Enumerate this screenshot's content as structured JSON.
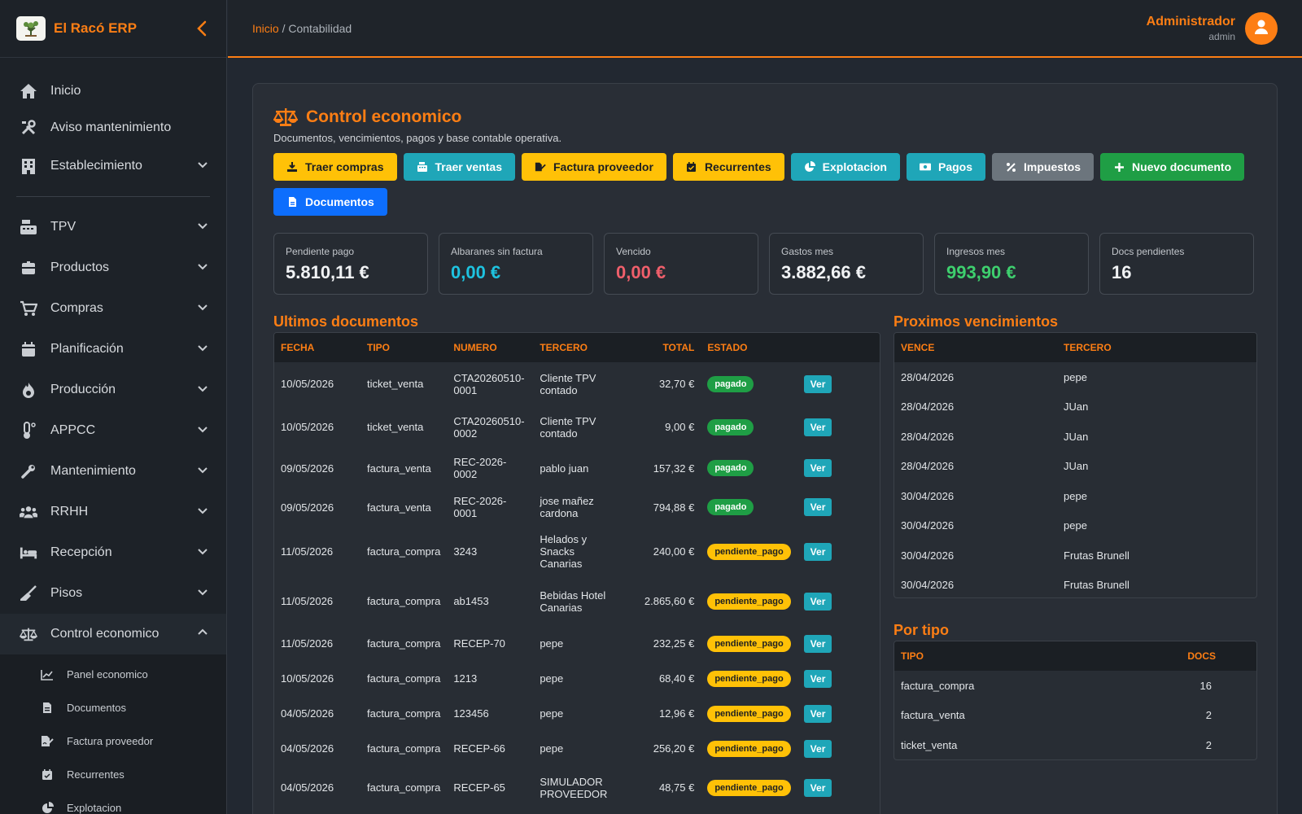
{
  "brand": {
    "name": "El Racó ERP"
  },
  "sidebar": {
    "items": [
      {
        "label": "Inicio",
        "icon": "home-icon"
      },
      {
        "label": "Aviso mantenimiento",
        "icon": "tools-icon"
      },
      {
        "label": "Establecimiento",
        "icon": "building-icon"
      }
    ],
    "groups": [
      {
        "label": "TPV",
        "icon": "cash-register-icon"
      },
      {
        "label": "Productos",
        "icon": "box-icon"
      },
      {
        "label": "Compras",
        "icon": "cart-icon"
      },
      {
        "label": "Planificación",
        "icon": "calendar-icon"
      },
      {
        "label": "Producción",
        "icon": "fire-icon"
      },
      {
        "label": "APPCC",
        "icon": "thermometer-icon"
      },
      {
        "label": "Mantenimiento",
        "icon": "wrench-icon"
      },
      {
        "label": "RRHH",
        "icon": "users-icon"
      },
      {
        "label": "Recepción",
        "icon": "bed-icon"
      },
      {
        "label": "Pisos",
        "icon": "broom-icon"
      },
      {
        "label": "Control economico",
        "icon": "scale-icon"
      }
    ],
    "subitems": [
      {
        "label": "Panel economico",
        "icon": "chart-line-icon"
      },
      {
        "label": "Documentos",
        "icon": "file-icon"
      },
      {
        "label": "Factura proveedor",
        "icon": "file-signature-icon"
      },
      {
        "label": "Recurrentes",
        "icon": "calendar-check-icon"
      },
      {
        "label": "Explotacion",
        "icon": "pie-chart-icon"
      }
    ]
  },
  "topbar": {
    "breadcrumb_home": "Inicio",
    "breadcrumb_sep": " / ",
    "breadcrumb_current": "Contabilidad",
    "user_name": "Administrador",
    "user_role": "admin"
  },
  "page": {
    "title": "Control economico",
    "subtitle": "Documentos, vencimientos, pagos y base contable operativa."
  },
  "toolbar": {
    "traer_compras": "Traer compras",
    "traer_ventas": "Traer ventas",
    "factura_proveedor": "Factura proveedor",
    "recurrentes": "Recurrentes",
    "explotacion": "Explotacion",
    "pagos": "Pagos",
    "impuestos": "Impuestos",
    "nuevo_documento": "Nuevo documento",
    "documentos": "Documentos"
  },
  "kpis": [
    {
      "label": "Pendiente pago",
      "value": "5.810,11 €",
      "color": "#f1f3f5"
    },
    {
      "label": "Albaranes sin factura",
      "value": "0,00 €",
      "color": "#1ec3e0"
    },
    {
      "label": "Vencido",
      "value": "0,00 €",
      "color": "#ef5f6b"
    },
    {
      "label": "Gastos mes",
      "value": "3.882,66 €",
      "color": "#f1f3f5"
    },
    {
      "label": "Ingresos mes",
      "value": "993,90 €",
      "color": "#3ecf6e"
    },
    {
      "label": "Docs pendientes",
      "value": "16",
      "color": "#f1f3f5"
    }
  ],
  "docs": {
    "title": "Ultimos documentos",
    "headers": {
      "fecha": "FECHA",
      "tipo": "TIPO",
      "numero": "NUMERO",
      "tercero": "TERCERO",
      "total": "TOTAL",
      "estado": "ESTADO"
    },
    "view_label": "Ver",
    "rows": [
      {
        "fecha": "10/05/2026",
        "tipo": "ticket_venta",
        "numero": "CTA20260510-0001",
        "tercero": "Cliente TPV contado",
        "total": "32,70 €",
        "estado": "pagado"
      },
      {
        "fecha": "10/05/2026",
        "tipo": "ticket_venta",
        "numero": "CTA20260510-0002",
        "tercero": "Cliente TPV contado",
        "total": "9,00 €",
        "estado": "pagado"
      },
      {
        "fecha": "09/05/2026",
        "tipo": "factura_venta",
        "numero": "REC-2026-0002",
        "tercero": "pablo juan",
        "total": "157,32 €",
        "estado": "pagado"
      },
      {
        "fecha": "09/05/2026",
        "tipo": "factura_venta",
        "numero": "REC-2026-0001",
        "tercero": "jose mañez cardona",
        "total": "794,88 €",
        "estado": "pagado"
      },
      {
        "fecha": "11/05/2026",
        "tipo": "factura_compra",
        "numero": "3243",
        "tercero": "Helados y Snacks Canarias",
        "total": "240,00 €",
        "estado": "pendiente_pago"
      },
      {
        "fecha": "11/05/2026",
        "tipo": "factura_compra",
        "numero": "ab1453",
        "tercero": "Bebidas Hotel Canarias",
        "total": "2.865,60 €",
        "estado": "pendiente_pago"
      },
      {
        "fecha": "11/05/2026",
        "tipo": "factura_compra",
        "numero": "RECEP-70",
        "tercero": "pepe",
        "total": "232,25 €",
        "estado": "pendiente_pago"
      },
      {
        "fecha": "10/05/2026",
        "tipo": "factura_compra",
        "numero": "1213",
        "tercero": "pepe",
        "total": "68,40 €",
        "estado": "pendiente_pago"
      },
      {
        "fecha": "04/05/2026",
        "tipo": "factura_compra",
        "numero": "123456",
        "tercero": "pepe",
        "total": "12,96 €",
        "estado": "pendiente_pago"
      },
      {
        "fecha": "04/05/2026",
        "tipo": "factura_compra",
        "numero": "RECEP-66",
        "tercero": "pepe",
        "total": "256,20 €",
        "estado": "pendiente_pago"
      },
      {
        "fecha": "04/05/2026",
        "tipo": "factura_compra",
        "numero": "RECEP-65",
        "tercero": "SIMULADOR PROVEEDOR",
        "total": "48,75 €",
        "estado": "pendiente_pago"
      }
    ]
  },
  "vencimientos": {
    "title": "Proximos vencimientos",
    "headers": {
      "vence": "VENCE",
      "tercero": "TERCERO"
    },
    "rows": [
      {
        "vence": "28/04/2026",
        "tercero": "pepe"
      },
      {
        "vence": "28/04/2026",
        "tercero": "JUan"
      },
      {
        "vence": "28/04/2026",
        "tercero": "JUan"
      },
      {
        "vence": "28/04/2026",
        "tercero": "JUan"
      },
      {
        "vence": "30/04/2026",
        "tercero": "pepe"
      },
      {
        "vence": "30/04/2026",
        "tercero": "pepe"
      },
      {
        "vence": "30/04/2026",
        "tercero": "Frutas Brunell"
      },
      {
        "vence": "30/04/2026",
        "tercero": "Frutas Brunell"
      }
    ]
  },
  "por_tipo": {
    "title": "Por tipo",
    "headers": {
      "tipo": "TIPO",
      "docs": "DOCS"
    },
    "rows": [
      {
        "tipo": "factura_compra",
        "docs": "16"
      },
      {
        "tipo": "factura_venta",
        "docs": "2"
      },
      {
        "tipo": "ticket_venta",
        "docs": "2"
      }
    ]
  },
  "colors": {
    "accent": "#fd7e14",
    "warning": "#ffc107",
    "info": "#1fa6b8",
    "success": "#1f9e45",
    "primary": "#0d6efd"
  }
}
